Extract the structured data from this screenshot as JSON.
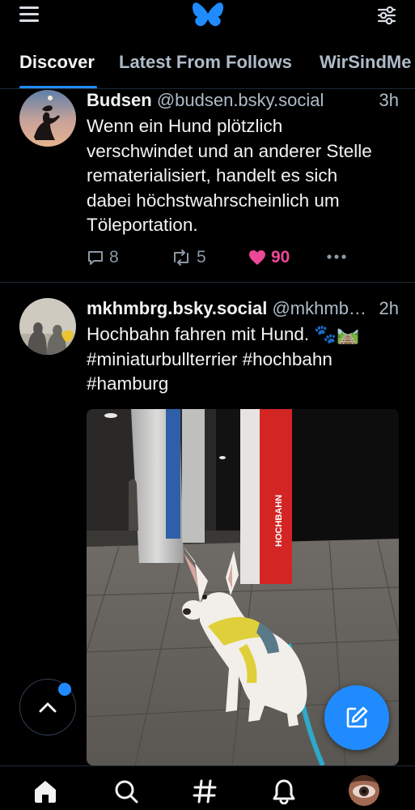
{
  "header": {
    "menu_icon": "hamburger-menu-icon",
    "logo_icon": "butterfly-logo-icon",
    "feeds_icon": "sliders-icon",
    "brand_color": "#208bfe"
  },
  "tabs": [
    {
      "label": "Discover",
      "active": true
    },
    {
      "label": "Latest From Follows",
      "active": false
    },
    {
      "label": "WirSindMe",
      "active": false
    }
  ],
  "posts": [
    {
      "display_name": "Budsen",
      "handle": "@budsen.bsky.social",
      "time": "3h",
      "lines": [
        "Wenn ein Hund plötzlich",
        "verschwindet und an anderer Stelle",
        "rematerialisiert, handelt es sich",
        "dabei höchstwahrscheinlich um",
        "Töleportation."
      ],
      "replies": "8",
      "reposts": "5",
      "likes": "90",
      "liked": true
    },
    {
      "display_name": "mkhmbrg.bsky.social",
      "handle": "@mkhmb…",
      "time": "2h",
      "lines": [
        "Hochbahn fahren mit Hund. 🐾🛤️",
        "#miniaturbullterrier #hochbahn",
        "#hamburg"
      ],
      "image_sign_text": "HOCHBAHN"
    }
  ],
  "bottom_nav": [
    {
      "icon": "home-icon",
      "active": true
    },
    {
      "icon": "search-icon",
      "active": false
    },
    {
      "icon": "hashtag-feeds-icon",
      "active": false
    },
    {
      "icon": "notifications-bell-icon",
      "active": false
    },
    {
      "icon": "profile-avatar-icon",
      "active": false
    }
  ],
  "floating": {
    "scroll_top_icon": "chevron-up-icon",
    "compose_icon": "compose-pencil-icon"
  }
}
